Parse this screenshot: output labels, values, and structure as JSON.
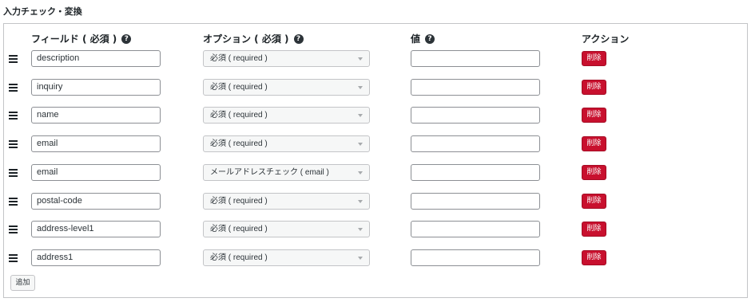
{
  "section": {
    "title": "入力チェック・変換"
  },
  "columns": {
    "field": "フィールド ( 必須 )",
    "option": "オプション ( 必須 )",
    "value": "値",
    "action": "アクション"
  },
  "rows": [
    {
      "field": "description",
      "option": "必須 ( required )",
      "value": ""
    },
    {
      "field": "inquiry",
      "option": "必須 ( required )",
      "value": ""
    },
    {
      "field": "name",
      "option": "必須 ( required )",
      "value": ""
    },
    {
      "field": "email",
      "option": "必須 ( required )",
      "value": ""
    },
    {
      "field": "email",
      "option": "メールアドレスチェック ( email )",
      "value": ""
    },
    {
      "field": "postal-code",
      "option": "必須 ( required )",
      "value": ""
    },
    {
      "field": "address-level1",
      "option": "必須 ( required )",
      "value": ""
    },
    {
      "field": "address1",
      "option": "必須 ( required )",
      "value": ""
    }
  ],
  "buttons": {
    "delete": "削除",
    "add": "追加"
  },
  "icons": {
    "help": "question-circle-icon",
    "drag": "drag-handle-icon"
  },
  "colors": {
    "delete_bg": "#c8102e",
    "border": "#c3c4c7",
    "text": "#1d2327"
  }
}
